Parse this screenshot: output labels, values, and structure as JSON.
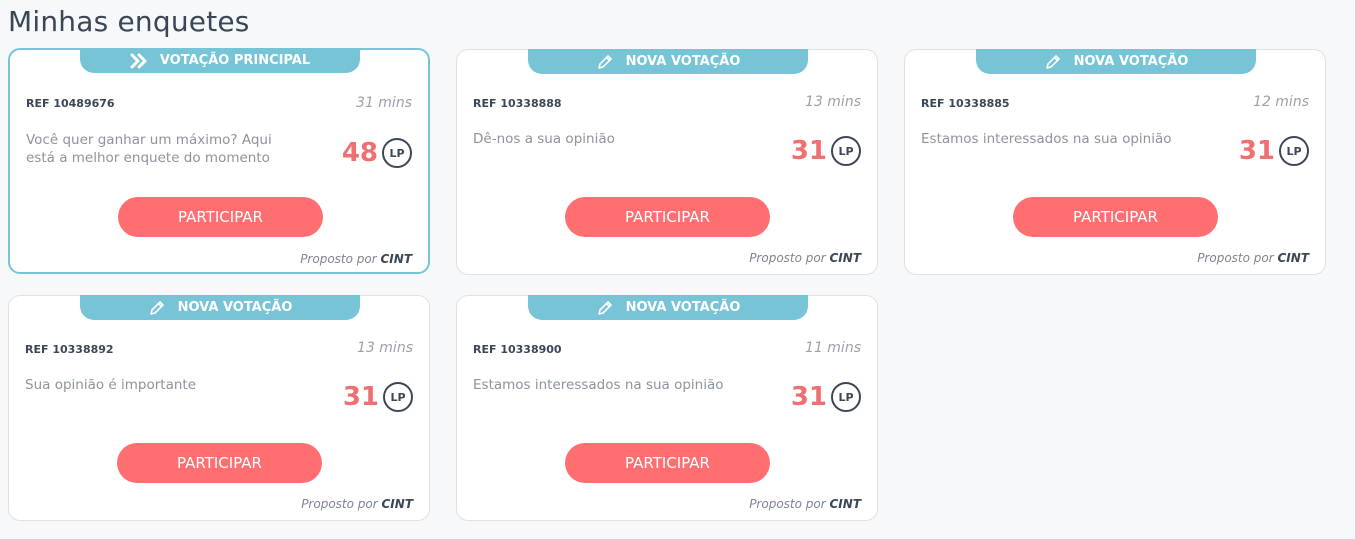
{
  "page": {
    "title": "Minhas enquetes"
  },
  "colors": {
    "accent": "#77c4d6",
    "button": "#ff6f72",
    "points": "#f06f73"
  },
  "cards": [
    {
      "badge": "VOTAÇÃO PRINCIPAL",
      "badge_icon": "double-chevron-right-icon",
      "ref": "REF 10489676",
      "time": "31 mins",
      "description": "Você quer ganhar um máximo? Aqui está a melhor enquete do momento",
      "points": "48",
      "currency": "LP",
      "button": "PARTICIPAR",
      "proposed_prefix": "Proposto por",
      "proposed_by": "CINT"
    },
    {
      "badge": "NOVA VOTAÇÃO",
      "badge_icon": "pencil-icon",
      "ref": "REF 10338888",
      "time": "13 mins",
      "description": "Dê-nos a sua opinião",
      "points": "31",
      "currency": "LP",
      "button": "PARTICIPAR",
      "proposed_prefix": "Proposto por",
      "proposed_by": "CINT"
    },
    {
      "badge": "NOVA VOTAÇÃO",
      "badge_icon": "pencil-icon",
      "ref": "REF 10338885",
      "time": "12 mins",
      "description": "Estamos interessados na sua opinião",
      "points": "31",
      "currency": "LP",
      "button": "PARTICIPAR",
      "proposed_prefix": "Proposto por",
      "proposed_by": "CINT"
    },
    {
      "badge": "NOVA VOTAÇÃO",
      "badge_icon": "pencil-icon",
      "ref": "REF 10338892",
      "time": "13 mins",
      "description": "Sua opinião é importante",
      "points": "31",
      "currency": "LP",
      "button": "PARTICIPAR",
      "proposed_prefix": "Proposto por",
      "proposed_by": "CINT"
    },
    {
      "badge": "NOVA VOTAÇÃO",
      "badge_icon": "pencil-icon",
      "ref": "REF 10338900",
      "time": "11 mins",
      "description": "Estamos interessados na sua opinião",
      "points": "31",
      "currency": "LP",
      "button": "PARTICIPAR",
      "proposed_prefix": "Proposto por",
      "proposed_by": "CINT"
    }
  ]
}
